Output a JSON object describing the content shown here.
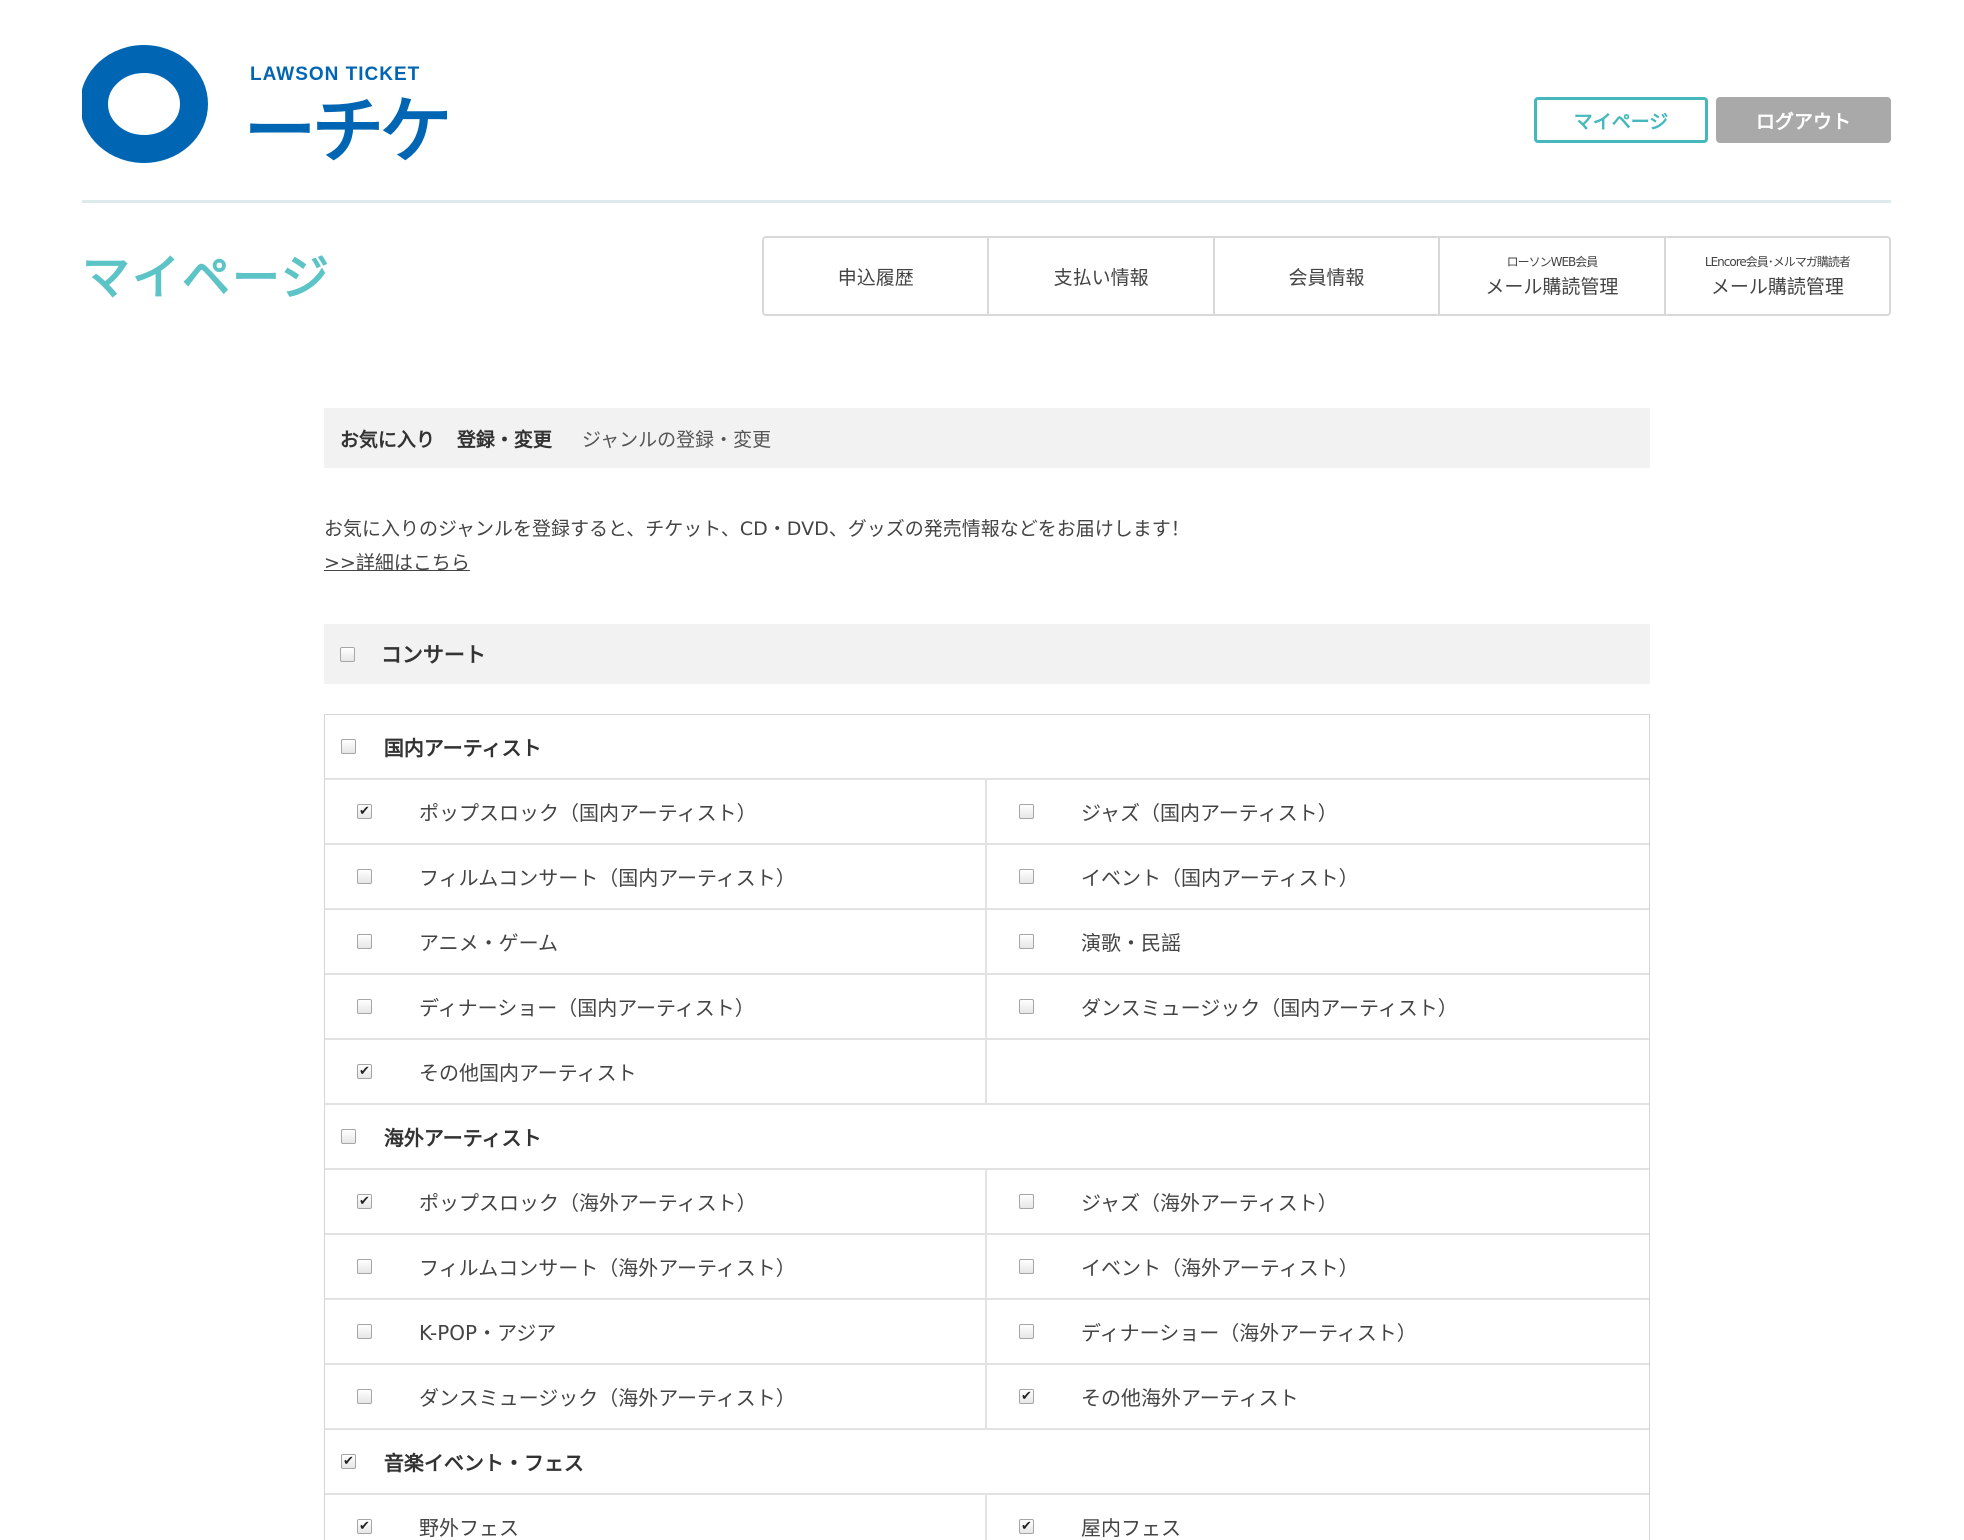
{
  "header": {
    "logo_text_en": "LAWSON TICKET",
    "logo_text_jp": "ーチケ",
    "mypage_button": "マイページ",
    "logout_button": "ログアウト"
  },
  "page_title": "マイページ",
  "nav": [
    {
      "sub": "",
      "label": "申込履歴"
    },
    {
      "sub": "",
      "label": "支払い情報"
    },
    {
      "sub": "",
      "label": "会員情報"
    },
    {
      "sub": "ローソンWEB会員",
      "label": "メール購読管理"
    },
    {
      "sub": "LEncore会員･メルマガ購読者",
      "label": "メール購読管理"
    }
  ],
  "section": {
    "title1": "お気に入り",
    "title2": "登録・変更",
    "subtitle": "ジャンルの登録・変更"
  },
  "intro": {
    "text": "お気に入りのジャンルを登録すると、チケット、CD・DVD、グッズの発売情報などをお届けします！",
    "link": ">>詳細はこちら"
  },
  "genre": {
    "label": "コンサート",
    "checked": false
  },
  "groups": [
    {
      "label": "国内アーティスト",
      "checked": false,
      "items": [
        {
          "label": "ポップスロック（国内アーティスト）",
          "checked": true
        },
        {
          "label": "ジャズ（国内アーティスト）",
          "checked": false
        },
        {
          "label": "フィルムコンサート（国内アーティスト）",
          "checked": false
        },
        {
          "label": "イベント（国内アーティスト）",
          "checked": false
        },
        {
          "label": "アニメ・ゲーム",
          "checked": false
        },
        {
          "label": "演歌・民謡",
          "checked": false
        },
        {
          "label": "ディナーショー（国内アーティスト）",
          "checked": false
        },
        {
          "label": "ダンスミュージック（国内アーティスト）",
          "checked": false
        },
        {
          "label": "その他国内アーティスト",
          "checked": true
        }
      ]
    },
    {
      "label": "海外アーティスト",
      "checked": false,
      "items": [
        {
          "label": "ポップスロック（海外アーティスト）",
          "checked": true
        },
        {
          "label": "ジャズ（海外アーティスト）",
          "checked": false
        },
        {
          "label": "フィルムコンサート（海外アーティスト）",
          "checked": false
        },
        {
          "label": "イベント（海外アーティスト）",
          "checked": false
        },
        {
          "label": "K-POP・アジア",
          "checked": false
        },
        {
          "label": "ディナーショー（海外アーティスト）",
          "checked": false
        },
        {
          "label": "ダンスミュージック（海外アーティスト）",
          "checked": false
        },
        {
          "label": "その他海外アーティスト",
          "checked": true
        }
      ]
    },
    {
      "label": "音楽イベント・フェス",
      "checked": true,
      "items": [
        {
          "label": "野外フェス",
          "checked": true
        },
        {
          "label": "屋内フェス",
          "checked": true
        }
      ]
    }
  ],
  "colors": {
    "brand_blue": "#0066b3",
    "accent_teal": "#45b8be",
    "title_teal": "#5cc4c6",
    "logout_gray": "#a9a9a9",
    "panel_gray": "#f2f2f2"
  }
}
